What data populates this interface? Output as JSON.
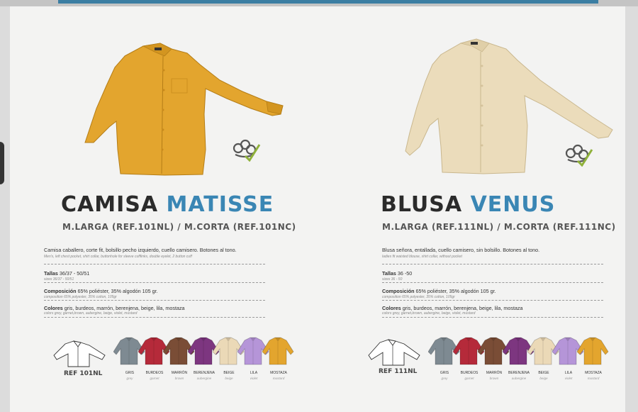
{
  "colors": {
    "accent_blue": "#3a86b4",
    "mostaza": "#e3a52e",
    "beige": "#ebdcbb"
  },
  "products": [
    {
      "title_main": "CAMISA",
      "title_accent": "MATISSE",
      "subtitle": "M.LARGA (REF.101NL) / M.CORTA (REF.101NC)",
      "description": "Camisa caballero, corte fit, bolsillo pecho izquierdo, cuello camisero. Botones al tono.",
      "description_en": "Men's, left chest pocket, shirt collar, buttonhole for sleeve cufflinks, double eyelet, 2 button cuff",
      "tallas_label": "Tallas",
      "tallas_value": "36/37 - 50/51",
      "tallas_en": "sizes 36/37 - 50/51",
      "composicion_label": "Composición",
      "composicion_value": "65% poliéster, 35% algodón 105 gr.",
      "composicion_en": "composition 65% polyester, 35% cotton, 105gr",
      "colores_label": "Colores",
      "colores_value": "gris, burdeos, marrón, berenjena, beige, lila, mostaza",
      "colores_en": "colors grey, garnet,brown, aubergine, beige, violet, mustard",
      "ref": "REF 101NL",
      "swatches": [
        {
          "name": "GRIS",
          "en": "grey",
          "color": "#7e8a92"
        },
        {
          "name": "BURDEOS",
          "en": "garnet",
          "color": "#b52a3a"
        },
        {
          "name": "MARRÓN",
          "en": "brown",
          "color": "#7a4d36"
        },
        {
          "name": "BERENJENA",
          "en": "aubergine",
          "color": "#7d3680"
        },
        {
          "name": "BEIGE",
          "en": "beige",
          "color": "#ebd9b7"
        },
        {
          "name": "LILA",
          "en": "violet",
          "color": "#b595d8"
        },
        {
          "name": "MOSTAZA",
          "en": "mustard",
          "color": "#e3a52e"
        }
      ]
    },
    {
      "title_main": "BLUSA",
      "title_accent": "VENUS",
      "subtitle": "M.LARGA (REF.111NL) / M.CORTA (REF.111NC)",
      "description": "Blusa señora, entallada, cuello camisero, sin bolsillo. Botones al tono.",
      "description_en": "ladies fit waisted blouse, shirt collar, without pocket",
      "tallas_label": "Tallas",
      "tallas_value": "36 -50",
      "tallas_en": "sizes 36 - 50",
      "composicion_label": "Composición",
      "composicion_value": "65% poliéster, 35% algodón 105 gr.",
      "composicion_en": "composition 65% polyester, 35% cotton, 105gr",
      "colores_label": "Colores",
      "colores_value": "gris, burdeos, marrón, berenjena, beige, lila, mostaza",
      "colores_en": "colors grey, garnet,brown, aubergine, beige, violet, mustard",
      "ref": "REF 111NL",
      "swatches": [
        {
          "name": "GRIS",
          "en": "grey",
          "color": "#7e8a92"
        },
        {
          "name": "BURDEOS",
          "en": "garnet",
          "color": "#b52a3a"
        },
        {
          "name": "MARRÓN",
          "en": "brown",
          "color": "#7a4d36"
        },
        {
          "name": "BERENJENA",
          "en": "aubergine",
          "color": "#7d3680"
        },
        {
          "name": "BEIGE",
          "en": "beige",
          "color": "#ebd9b7"
        },
        {
          "name": "LILA",
          "en": "violet",
          "color": "#b595d8"
        },
        {
          "name": "MOSTAZA",
          "en": "mustard",
          "color": "#e3a52e"
        }
      ]
    }
  ]
}
